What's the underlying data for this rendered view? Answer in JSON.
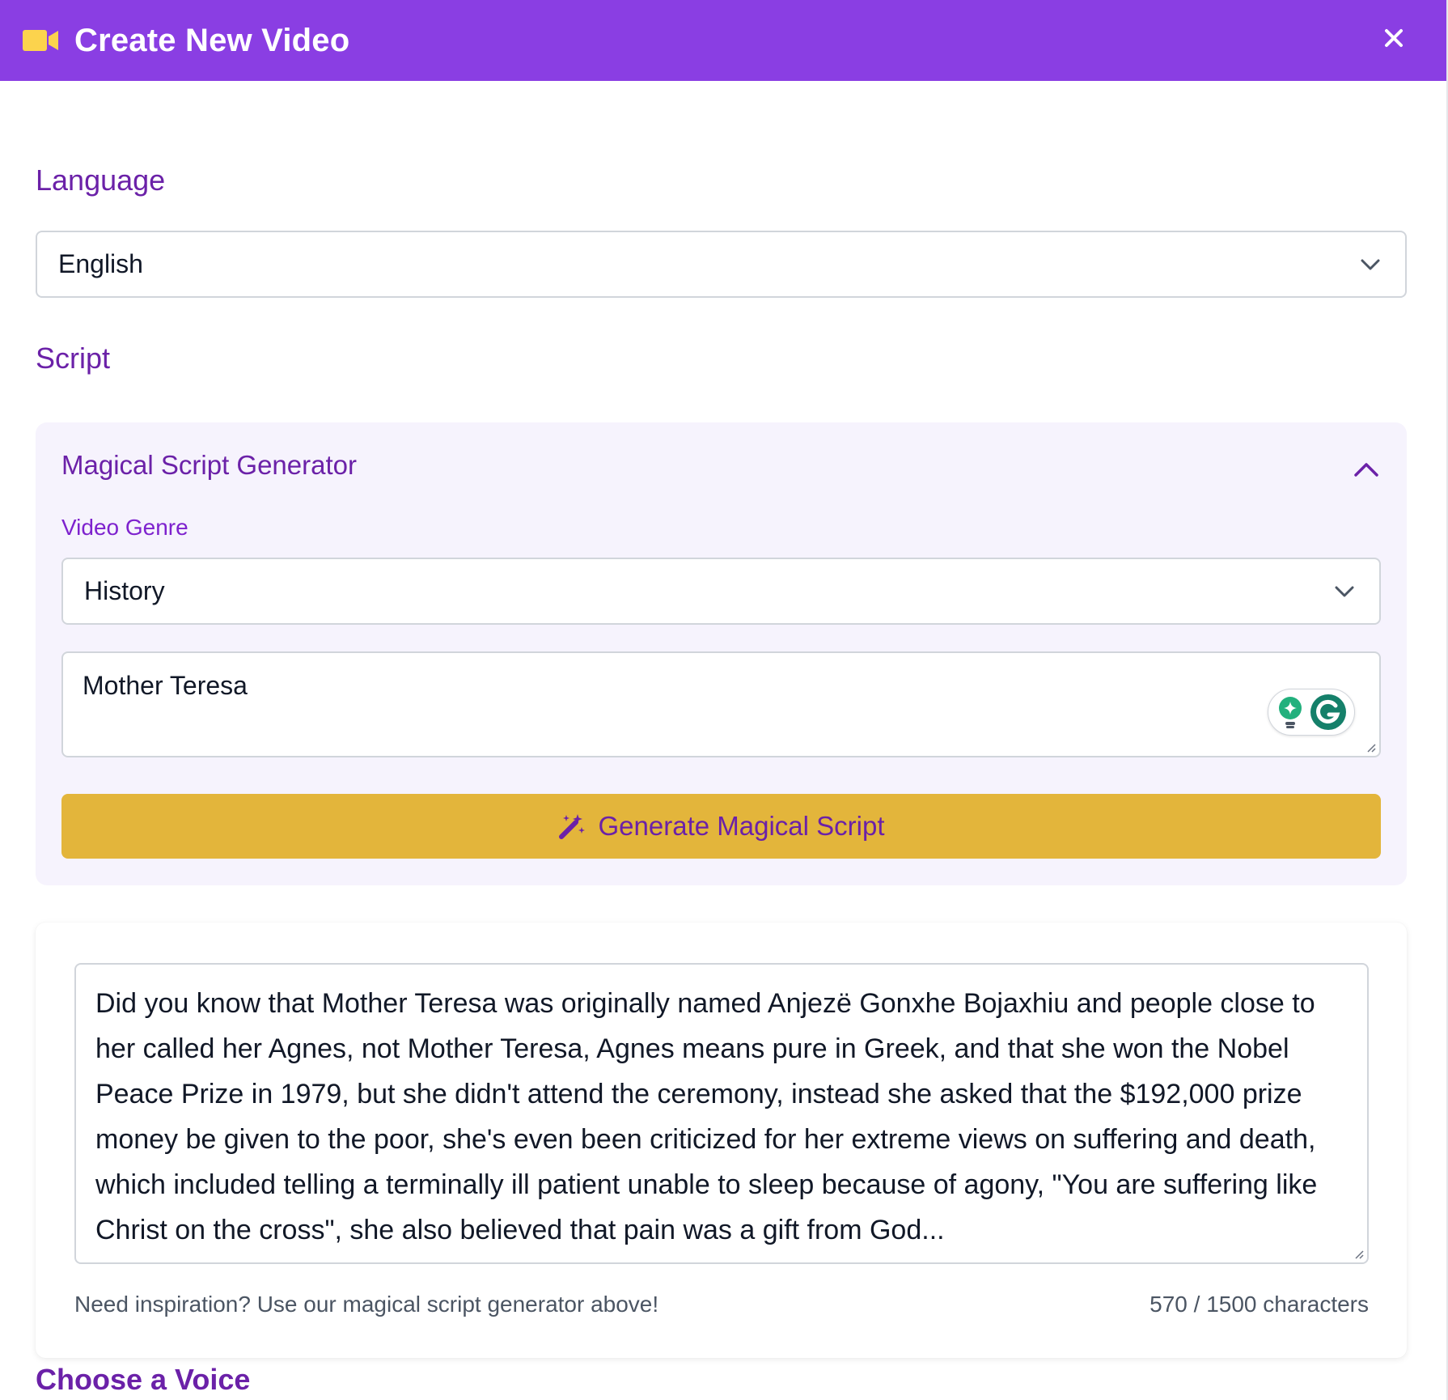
{
  "modal": {
    "title": "Create New Video",
    "close_label": "×"
  },
  "language": {
    "label": "Language",
    "selected": "English"
  },
  "script": {
    "label": "Script",
    "generator": {
      "title": "Magical Script Generator",
      "genre_label": "Video Genre",
      "genre_selected": "History",
      "topic_value": "Mother Teresa",
      "generate_label": "Generate Magical Script"
    },
    "text": "Did you know that Mother Teresa was originally named Anjezë Gonxhe Bojaxhiu and people close to her called her Agnes, not Mother Teresa, Agnes means pure in Greek, and that she won the Nobel Peace Prize in 1979, but she didn't attend the ceremony, instead she asked that the $192,000 prize money be given to the poor, she's even been criticized for her extreme views on suffering and death, which included telling a terminally ill patient unable to sleep because of agony, \"You are suffering like Christ on the cross\", she also believed that pain was a gift from God...",
    "helper_text": "Need inspiration? Use our magical script generator above!",
    "counter": "570 / 1500 characters"
  },
  "voice": {
    "label": "Choose a Voice"
  },
  "colors": {
    "header": "#8a3ee3",
    "accent": "#6b21a8",
    "button": "#e3b53b",
    "panel": "#f6f3fd"
  },
  "icons": [
    "video-camera-icon",
    "close-icon",
    "chevron-down-icon",
    "chevron-up-icon",
    "magic-wand-icon",
    "grammarly-icon"
  ]
}
